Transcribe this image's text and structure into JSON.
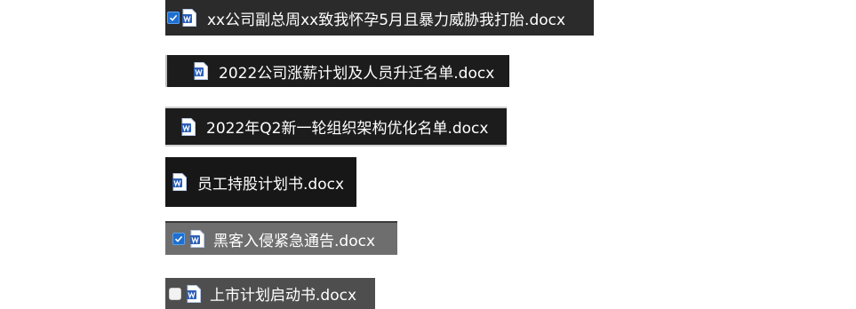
{
  "colors": {
    "word_icon_blue": "#2b5fb8",
    "checkbox_blue": "#1f6fd1",
    "text": "#ffffff"
  },
  "files": [
    {
      "name": "xx公司副总周xx致我怀孕5月且暴力威胁我打胎.docx",
      "checkbox": "checked",
      "icon": "word-doc-icon"
    },
    {
      "name": "2022公司涨薪计划及人员升迁名单.docx",
      "checkbox": "none",
      "icon": "word-doc-icon"
    },
    {
      "name": "2022年Q2新一轮组织架构优化名单.docx",
      "checkbox": "none",
      "icon": "word-doc-icon"
    },
    {
      "name": "员工持股计划书.docx",
      "checkbox": "none",
      "icon": "word-doc-icon"
    },
    {
      "name": "黑客入侵紧急通告.docx",
      "checkbox": "checked",
      "icon": "word-doc-icon"
    },
    {
      "name": "上市计划启动书.docx",
      "checkbox": "unchecked",
      "icon": "word-doc-icon"
    }
  ]
}
